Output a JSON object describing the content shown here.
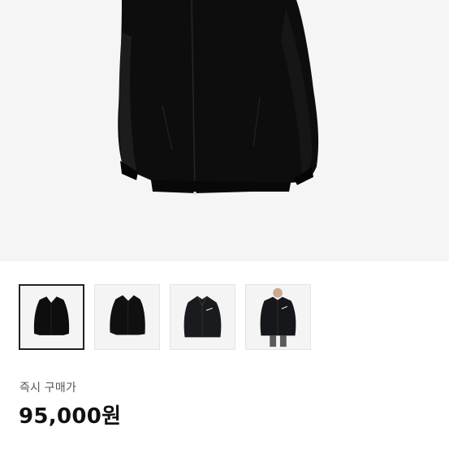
{
  "product": {
    "main_image": "black-zip-jacket-photo",
    "thumbnails": [
      {
        "icon": "black-jacket-front-thumb",
        "selected": true
      },
      {
        "icon": "black-jacket-side-thumb",
        "selected": false
      },
      {
        "icon": "black-jacket-logo-thumb",
        "selected": false
      },
      {
        "icon": "black-jacket-model-thumb",
        "selected": false
      }
    ],
    "price_label": "즉시 구매가",
    "price": "95,000원"
  },
  "colors": {
    "hero_bg": "#f5f5f5",
    "jacket": "#0d0d0d",
    "price_text": "#111111",
    "label_text": "#555555"
  }
}
